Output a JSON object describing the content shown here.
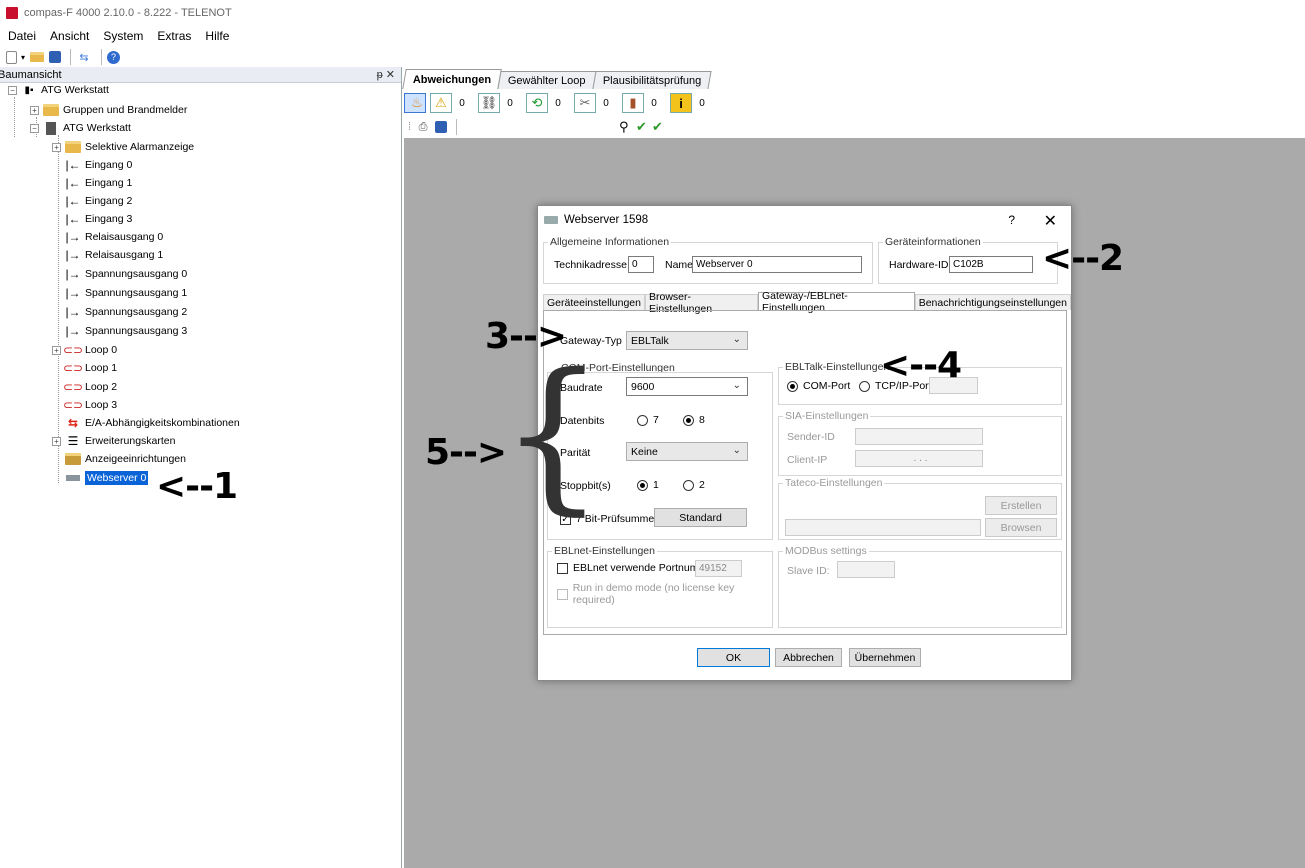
{
  "window": {
    "title": "compas-F 4000 2.10.0 - 8.222 - TELENOT"
  },
  "menu": [
    "Datei",
    "Ansicht",
    "System",
    "Extras",
    "Hilfe"
  ],
  "tree": {
    "header": "Baumansicht",
    "header_buttons": "2 ✕",
    "root": "ATG Werkstatt",
    "gruppen": "Gruppen und Brandmelder",
    "atg": "ATG Werkstatt",
    "items": [
      "Selektive Alarmanzeige",
      "Eingang 0",
      "Eingang 1",
      "Eingang 2",
      "Eingang 3",
      "Relaisausgang 0",
      "Relaisausgang 1",
      "Spannungsausgang 0",
      "Spannungsausgang 1",
      "Spannungsausgang 2",
      "Spannungsausgang 3",
      "Loop 0",
      "Loop 1",
      "Loop 2",
      "Loop 3",
      "E/A-Abhängigkeitskombinationen",
      "Erweiterungskarten",
      "Anzeigeeinrichtungen",
      "Webserver 0"
    ]
  },
  "tabs": [
    "Abweichungen",
    "Gewählter Loop",
    "Plausibilitätsprüfung"
  ],
  "counters": [
    "0",
    "0",
    "0",
    "0",
    "0",
    "0",
    "0"
  ],
  "dialog": {
    "title": "Webserver 1598",
    "help": "?",
    "close": "✕",
    "allg_group": "Allgemeine Informationen",
    "technik_label": "Technikadresse",
    "technik_value": "0",
    "name_label": "Name",
    "name_value": "Webserver 0",
    "geraete_group": "Geräteinformationen",
    "hwid_label": "Hardware-ID",
    "hwid_value": "C102B",
    "tabs": [
      "Geräteeinstellungen",
      "Browser-Einstellungen",
      "Gateway-/EBLnet-Einstellungen",
      "Benachrichtigungseinstellungen"
    ],
    "gateway_label": "Gateway-Typ",
    "gateway_value": "EBLTalk",
    "com_group": "COM-Port-Einstellungen",
    "baud_label": "Baudrate",
    "baud_value": "9600",
    "datenbits_label": "Datenbits",
    "datenbits_7": "7",
    "datenbits_8": "8",
    "paritaet_label": "Parität",
    "paritaet_value": "Keine",
    "stopp_label": "Stoppbit(s)",
    "stopp_1": "1",
    "stopp_2": "2",
    "pruef_label": "7 Bit-Prüfsumme",
    "standard_btn": "Standard",
    "ebltalk_group": "EBLTalk-Einstellungen",
    "comport_radio": "COM-Port",
    "tcpip_radio": "TCP/IP-Port",
    "sia_group": "SIA-Einstellungen",
    "sender_label": "Sender-ID",
    "client_label": "Client-IP",
    "client_value": ".   .   .",
    "tateco_group": "Tateco-Einstellungen",
    "erstellen_btn": "Erstellen",
    "browsen_btn": "Browsen",
    "eblnet_group": "EBLnet-Einstellungen",
    "eblnet_chk": "EBLnet verwende Portnummer",
    "eblnet_port": "49152",
    "demo_chk": "Run in demo mode (no license key required)",
    "modbus_group": "MODBus settings",
    "slave_label": "Slave ID:",
    "ok_btn": "OK",
    "abbrechen_btn": "Abbrechen",
    "uebernehmen_btn": "Übernehmen"
  },
  "annotations": {
    "a1": "<--1",
    "a2": "<--2",
    "a3": "3-->",
    "a4": "<--4",
    "a5": "5-->"
  }
}
